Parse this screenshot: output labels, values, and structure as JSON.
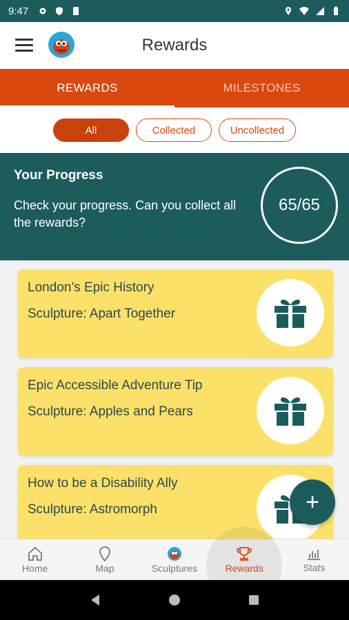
{
  "status_bar": {
    "time": "9:47"
  },
  "app_bar": {
    "title": "Rewards"
  },
  "tabs": [
    {
      "label": "REWARDS",
      "active": true
    },
    {
      "label": "MILESTONES",
      "active": false
    }
  ],
  "filters": [
    {
      "label": "All",
      "active": true
    },
    {
      "label": "Collected",
      "active": false
    },
    {
      "label": "Uncollected",
      "active": false
    }
  ],
  "progress": {
    "title": "Your Progress",
    "description": "Check your progress. Can you collect all the rewards?",
    "count": "65/65"
  },
  "rewards": [
    {
      "title": "London’s Epic History",
      "subtitle": "Sculpture: Apart Together",
      "icon": "gift-icon"
    },
    {
      "title": "Epic Accessible Adventure Tip",
      "subtitle": "Sculpture: Apples and Pears",
      "icon": "gift-icon"
    },
    {
      "title": "How to be a Disability Ally",
      "subtitle": "Sculpture: Astromorph",
      "icon": "gift-icon"
    }
  ],
  "fab": {
    "label": "+"
  },
  "bottom_nav": [
    {
      "label": "Home",
      "icon": "home-icon"
    },
    {
      "label": "Map",
      "icon": "map-pin-icon"
    },
    {
      "label": "Sculptures",
      "icon": "sculpture-icon"
    },
    {
      "label": "Rewards",
      "icon": "trophy-icon",
      "active": true
    },
    {
      "label": "Stats",
      "icon": "stats-icon"
    }
  ],
  "colors": {
    "primary": "#d9480f",
    "teal": "#1d5c5c",
    "card": "#fbe06a"
  }
}
